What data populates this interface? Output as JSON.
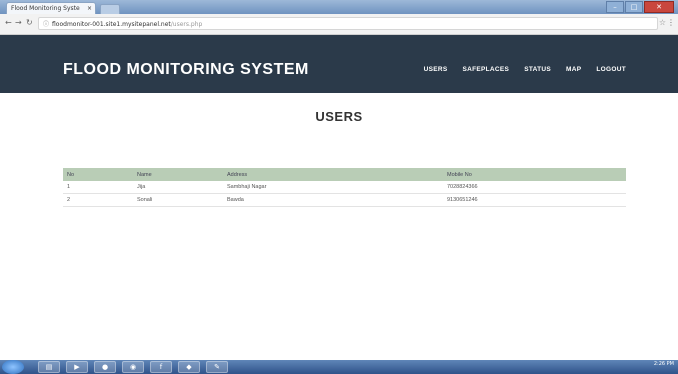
{
  "browser": {
    "tab_title": "Flood Monitoring Syste",
    "tab_close": "×",
    "url_host": "floodmonitor-001.site1.mysitepanel.net",
    "url_path": "/users.php"
  },
  "site": {
    "brand": "FLOOD MONITORING SYSTEM",
    "nav": [
      "USERS",
      "SAFEPLACES",
      "STATUS",
      "MAP",
      "LOGOUT"
    ]
  },
  "page": {
    "title": "USERS"
  },
  "table": {
    "headers": [
      "No",
      "Name",
      "Address",
      "Mobile No"
    ],
    "rows": [
      [
        "1",
        "Jija",
        "Sambhaji Nagar",
        "7028824366"
      ],
      [
        "2",
        "Sonali",
        "Bawda",
        "9130651246"
      ]
    ]
  },
  "taskbar": {
    "clock": "2:26 PM"
  }
}
